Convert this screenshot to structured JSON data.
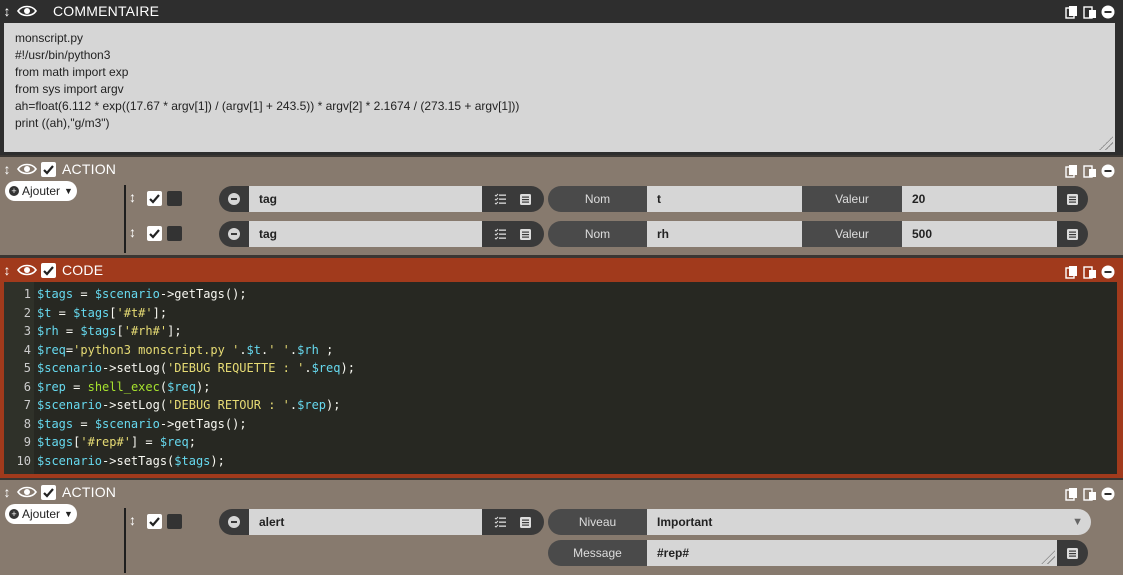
{
  "comment": {
    "title": "COMMENTAIRE",
    "lines": [
      "monscript.py",
      "#!/usr/bin/python3",
      "from math import exp",
      "from sys import argv",
      "ah=float(6.112 * exp((17.67 * argv[1]) / (argv[1] + 243.5)) * argv[2] * 2.1674 / (273.15 + argv[1]))",
      "print ((ah),\"g/m3\")"
    ]
  },
  "action1": {
    "title": "ACTION",
    "ajouter_label": "Ajouter",
    "rows": [
      {
        "command": "tag",
        "label1": "Nom",
        "value1": "t",
        "label2": "Valeur",
        "value2": "20"
      },
      {
        "command": "tag",
        "label1": "Nom",
        "value1": "rh",
        "label2": "Valeur",
        "value2": "500"
      }
    ]
  },
  "code": {
    "title": "CODE",
    "line_numbers": [
      "1",
      "2",
      "3",
      "4",
      "5",
      "6",
      "7",
      "8",
      "9",
      "10"
    ],
    "lines": [
      "$tags = $scenario->getTags();",
      "$t = $tags['#t#'];",
      "$rh = $tags['#rh#'];",
      "$req='python3 monscript.py '.$t.' '.$rh ;",
      "$scenario->setLog('DEBUG REQUETTE : '.$req);",
      "$rep = shell_exec($req);",
      "$scenario->setLog('DEBUG RETOUR : '.$rep);",
      "$tags = $scenario->getTags();",
      "$tags['#rep#'] = $req;",
      "$scenario->setTags($tags);"
    ]
  },
  "action2": {
    "title": "ACTION",
    "ajouter_label": "Ajouter",
    "command": "alert",
    "niveau_label": "Niveau",
    "niveau_value": "Important",
    "message_label": "Message",
    "message_value": "#rep#"
  },
  "colors": {
    "comment_bg": "#2e2e2e",
    "action_bg": "#877a6e",
    "code_bg": "#a13a1c",
    "editor_bg": "#272822"
  }
}
